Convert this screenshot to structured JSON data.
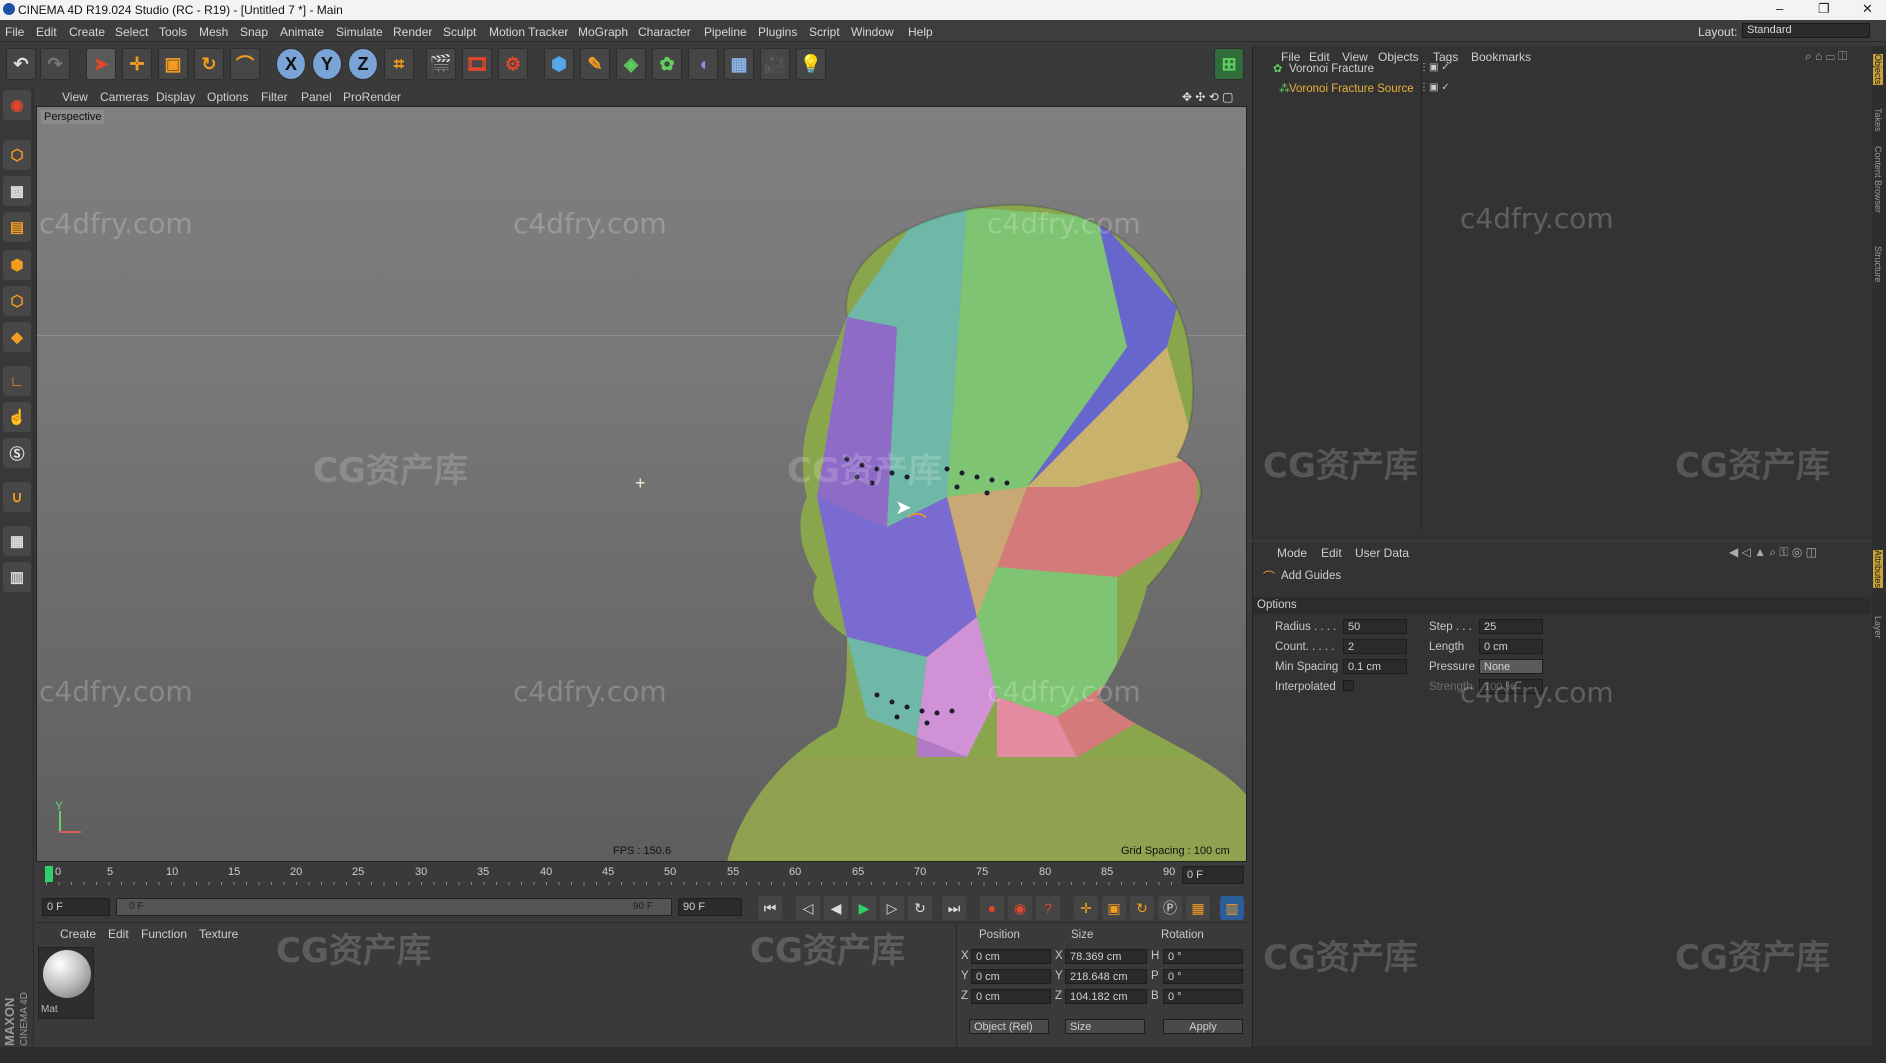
{
  "titlebar": {
    "title": "CINEMA 4D R19.024 Studio (RC - R19) - [Untitled 7 *] - Main",
    "min": "–",
    "max": "❐",
    "close": "✕"
  },
  "menubar": {
    "items": [
      "File",
      "Edit",
      "Create",
      "Select",
      "Tools",
      "Mesh",
      "Snap",
      "Animate",
      "Simulate",
      "Render",
      "Sculpt",
      "Motion Tracker",
      "MoGraph",
      "Character",
      "Pipeline",
      "Plugins",
      "Script",
      "Window",
      "Help"
    ],
    "layout_label": "Layout:",
    "layout_value": "Standard"
  },
  "toolbar": {
    "axis_x": "X",
    "axis_y": "Y",
    "axis_z": "Z"
  },
  "viewport": {
    "menu": [
      "View",
      "Cameras",
      "Display",
      "Options",
      "Filter",
      "Panel",
      "ProRender"
    ],
    "label": "Perspective",
    "fps": "FPS : 150.6",
    "grid_spacing": "Grid Spacing : 100 cm"
  },
  "watermarks": {
    "site": "c4dfry.com",
    "brand": "CG资产库"
  },
  "timeline": {
    "ticks": [
      "0",
      "5",
      "10",
      "15",
      "20",
      "25",
      "30",
      "35",
      "40",
      "45",
      "50",
      "55",
      "60",
      "65",
      "70",
      "75",
      "80",
      "85",
      "90"
    ],
    "current_frame": "0 F"
  },
  "transport": {
    "start": "0 F",
    "range_start": "0 F",
    "range_end": "90 F",
    "end": "90 F"
  },
  "materials": {
    "menu": [
      "Create",
      "Edit",
      "Function",
      "Texture"
    ],
    "mat_label": "Mat"
  },
  "coords": {
    "headers": [
      "Position",
      "Size",
      "Rotation"
    ],
    "rows": [
      {
        "axis": "X",
        "pos": "0 cm",
        "size_axis": "X",
        "size": "78.369 cm",
        "rot_axis": "H",
        "rot": "0 °"
      },
      {
        "axis": "Y",
        "pos": "0 cm",
        "size_axis": "Y",
        "size": "218.648 cm",
        "rot_axis": "P",
        "rot": "0 °"
      },
      {
        "axis": "Z",
        "pos": "0 cm",
        "size_axis": "Z",
        "size": "104.182 cm",
        "rot_axis": "B",
        "rot": "0 °"
      }
    ],
    "mode": "Object (Rel)",
    "size_mode": "Size",
    "apply": "Apply"
  },
  "objects": {
    "menu": [
      "File",
      "Edit",
      "View",
      "Objects",
      "Tags",
      "Bookmarks"
    ],
    "items": [
      {
        "name": "Voronoi Fracture",
        "color": "#d0d0d0"
      },
      {
        "name": "Voronoi Fracture Source",
        "color": "#e8b13c"
      }
    ]
  },
  "attributes": {
    "menu": [
      "Mode",
      "Edit",
      "User Data"
    ],
    "tool": "Add Guides",
    "section": "Options",
    "radius_label": "Radius . . . .",
    "radius": "50",
    "step_label": "Step . . .",
    "step": "25",
    "count_label": "Count. . . . .",
    "count": "2",
    "length_label": "Length",
    "length": "0 cm",
    "minspacing_label": "Min Spacing",
    "minspacing": "0.1 cm",
    "pressure_label": "Pressure",
    "pressure": "None",
    "interpolated_label": "Interpolated",
    "strength_label": "Strength",
    "strength": "100 %"
  },
  "side_tabs": [
    "Objects",
    "Takes",
    "Content Browser",
    "Structure",
    "Attributes",
    "Layer"
  ],
  "brand": {
    "maxon": "MAXON",
    "c4d": "CINEMA 4D"
  }
}
